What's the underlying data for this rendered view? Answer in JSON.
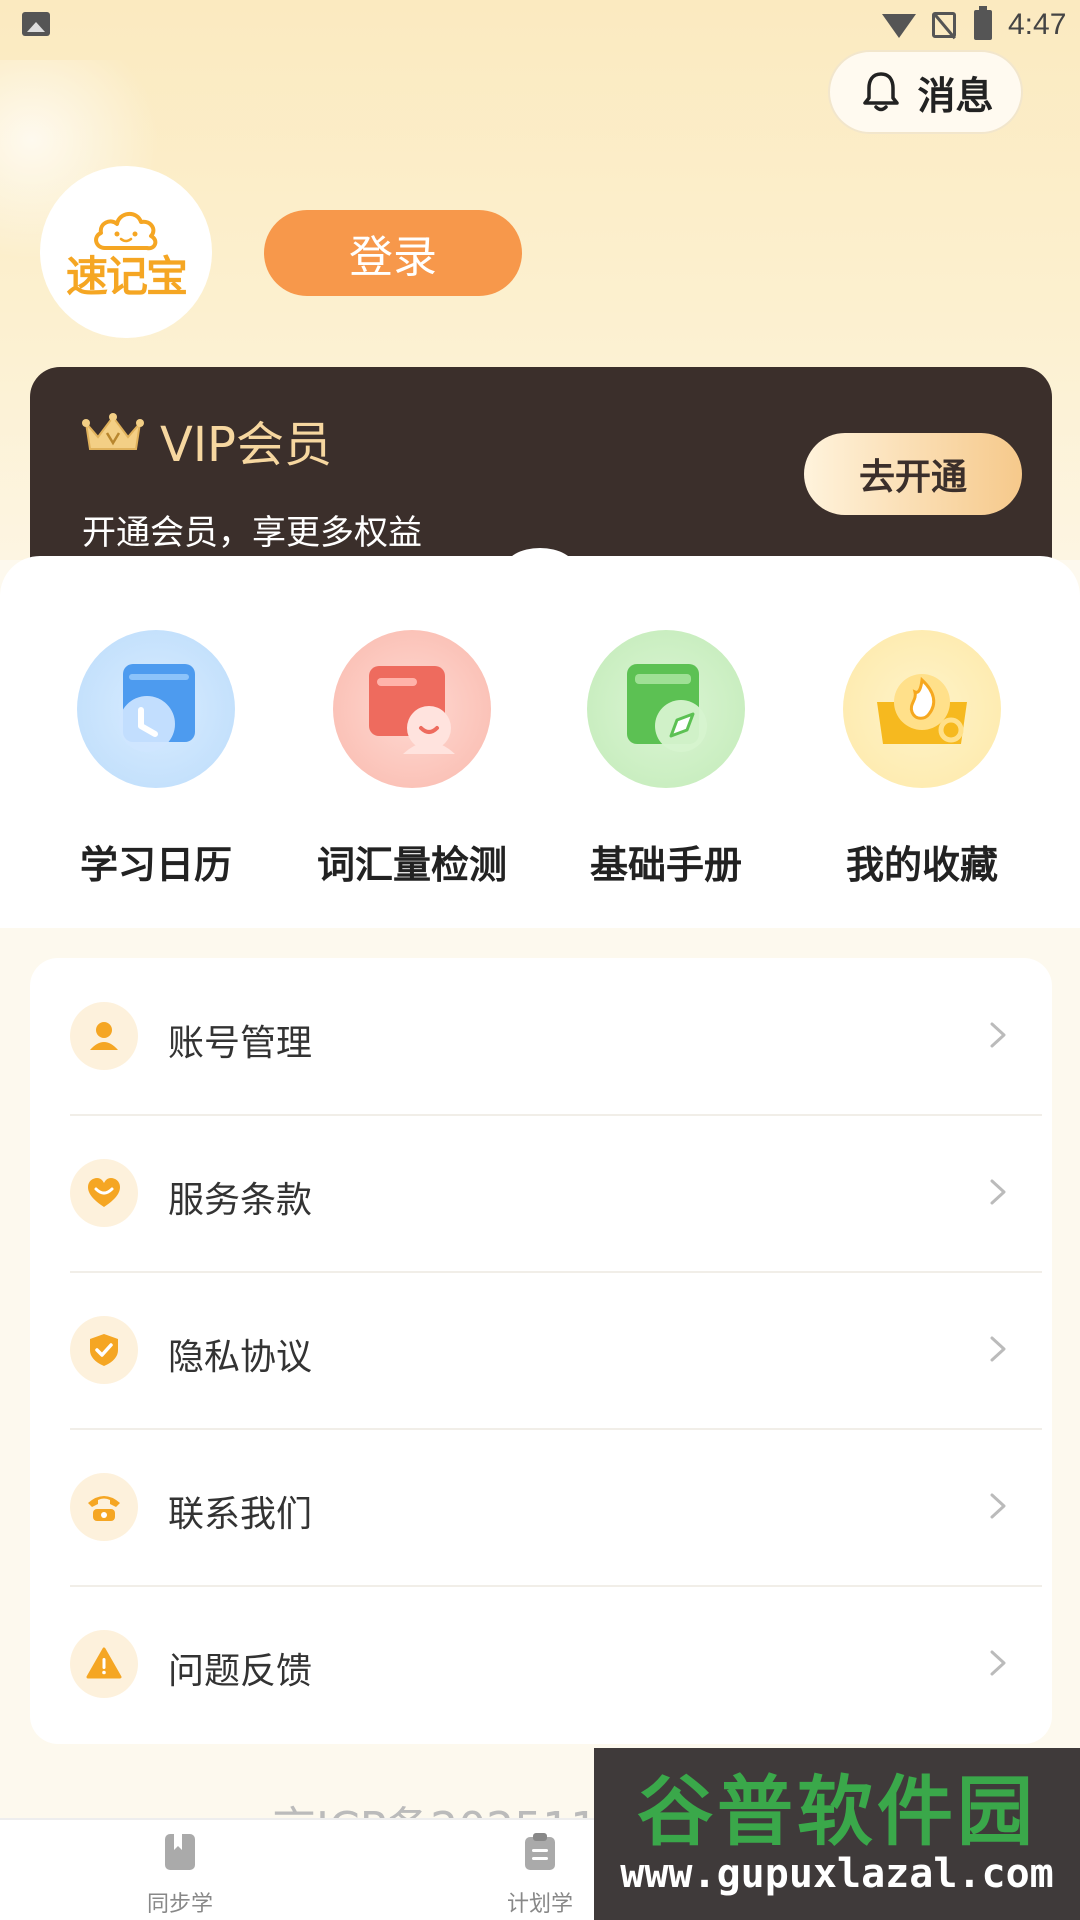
{
  "status_bar": {
    "time": "4:47"
  },
  "header": {
    "message_label": "消息"
  },
  "profile": {
    "logo_text": "速记宝",
    "login_label": "登录"
  },
  "vip": {
    "title": "VIP会员",
    "subtitle": "开通会员，享更多权益",
    "cta_label": "去开通"
  },
  "features": [
    {
      "label": "学习日历",
      "icon": "calendar-clock-icon",
      "color": "#5aa6f2"
    },
    {
      "label": "词汇量检测",
      "icon": "vocab-test-icon",
      "color": "#f27a6e"
    },
    {
      "label": "基础手册",
      "icon": "handbook-compass-icon",
      "color": "#62c45c"
    },
    {
      "label": "我的收藏",
      "icon": "favorites-fire-icon",
      "color": "#f5bf2c"
    }
  ],
  "menu": [
    {
      "label": "账号管理",
      "icon": "user-icon"
    },
    {
      "label": "服务条款",
      "icon": "heart-icon"
    },
    {
      "label": "隐私协议",
      "icon": "shield-icon"
    },
    {
      "label": "联系我们",
      "icon": "phone-icon"
    },
    {
      "label": "问题反馈",
      "icon": "warning-icon"
    }
  ],
  "footer": {
    "icp": "京ICP备202511"
  },
  "tabbar": [
    {
      "label": "同步学",
      "icon": "book-icon"
    },
    {
      "label": "计划学",
      "icon": "clipboard-icon"
    }
  ],
  "watermark": {
    "line1": "谷普软件园",
    "line2": "www.gupuxlazal.com"
  },
  "colors": {
    "accent": "#f7984b",
    "vip_bg": "#3b2f2b",
    "vip_gold": "#f6d7a0",
    "icon_orange": "#f5a623"
  }
}
